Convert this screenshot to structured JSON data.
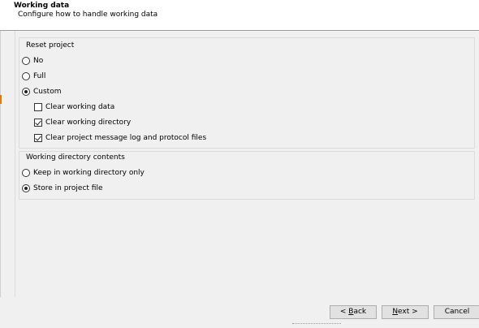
{
  "header": {
    "title": "Working data",
    "subtitle": "Configure how to handle working data"
  },
  "reset_group": {
    "title": "Reset project",
    "options": [
      {
        "label": "No",
        "selected": false
      },
      {
        "label": "Full",
        "selected": false
      },
      {
        "label": "Custom",
        "selected": true
      }
    ],
    "custom_checks": [
      {
        "label": "Clear working data",
        "checked": false
      },
      {
        "label": "Clear working directory",
        "checked": true
      },
      {
        "label": "Clear project message log and protocol files",
        "checked": true
      }
    ]
  },
  "workdir_group": {
    "title": "Working directory contents",
    "options": [
      {
        "label": "Keep in working directory only",
        "selected": false
      },
      {
        "label": "Store in project file",
        "selected": true
      }
    ]
  },
  "footer": {
    "back_prefix": "< ",
    "back_accel": "B",
    "back_rest": "ack",
    "next_accel": "N",
    "next_rest": "ext >",
    "cancel_label": "Cancel"
  }
}
